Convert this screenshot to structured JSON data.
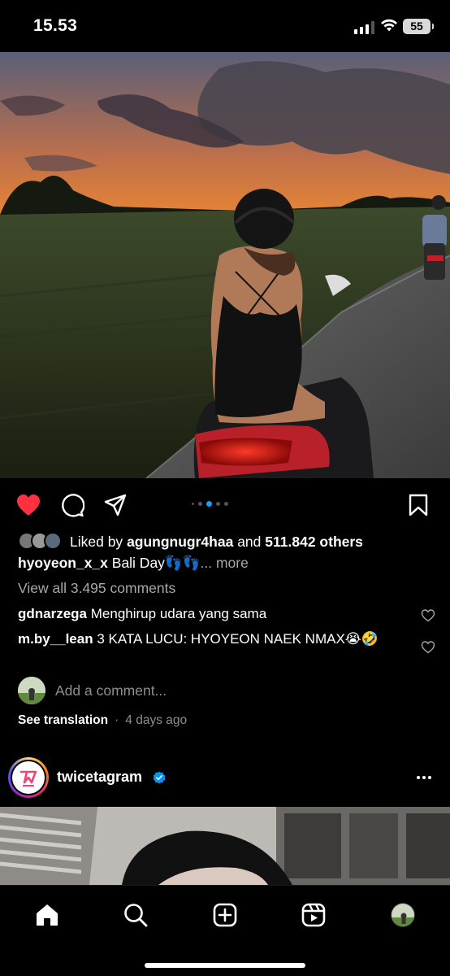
{
  "status_bar": {
    "time": "15.53",
    "battery": "55"
  },
  "post": {
    "icons": [
      "heart-filled-icon",
      "comment-icon",
      "share-icon",
      "bookmark-icon"
    ],
    "carousel_dots": 5,
    "carousel_active_index": 2,
    "liked_by_prefix": "Liked by",
    "liked_by_user": "agungnugr4haa",
    "liked_by_and": "and",
    "liked_by_others": "511.842 others",
    "caption_user": "hyoyeon_x_x",
    "caption_text": "Bali Day👣👣",
    "caption_more": "... more",
    "view_all_comments": "View all 3.495 comments",
    "comments": [
      {
        "user": "gdnarzega",
        "text": "Menghirup udara yang sama"
      },
      {
        "user": "m.by__lean",
        "text": "3 KATA LUCU: HYOYEON NAEK NMAX😭🤣"
      }
    ],
    "add_comment_placeholder": "Add a comment...",
    "see_translation": "See translation",
    "separator": "·",
    "time_ago": "4 days ago"
  },
  "next_post": {
    "username": "twicetagram",
    "verified": true
  },
  "bottom_nav": {
    "items": [
      "home-icon",
      "search-icon",
      "create-icon",
      "reels-icon",
      "profile-avatar"
    ],
    "active": "home-icon"
  },
  "colors": {
    "background": "#000000",
    "like_red": "#ff3040",
    "active_dot": "#1d9bf0",
    "verified_blue": "#0095f6",
    "muted_text": "#a8a8a8"
  }
}
